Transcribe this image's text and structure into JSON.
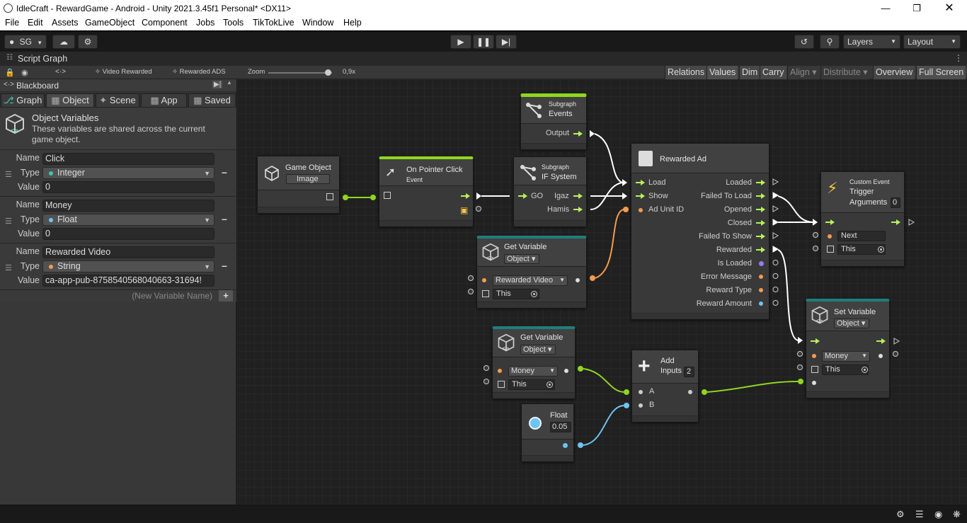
{
  "window": {
    "title": "IdleCraft - RewardGame - Android - Unity 2021.3.45f1 Personal* <DX11>"
  },
  "menu": [
    "File",
    "Edit",
    "Assets",
    "GameObject",
    "Component",
    "Jobs",
    "Tools",
    "TikTokLive",
    "Window",
    "Help"
  ],
  "toolbar": {
    "account": "SG",
    "layers": "Layers",
    "layout": "Layout"
  },
  "panel": {
    "title": "Script Graph"
  },
  "graph_toolbar": {
    "video_rewarded": "Video Rewarded",
    "rewarded_ads": "Rewarded ADS",
    "zoom_label": "Zoom",
    "zoom_value": "0,9x",
    "buttons": [
      "Relations",
      "Values",
      "Dim",
      "Carry",
      "Align ▾",
      "Distribute ▾",
      "Overview",
      "Full Screen"
    ]
  },
  "blackboard": {
    "title": "Blackboard",
    "tabs": [
      "Graph",
      "Object",
      "Scene",
      "App",
      "Saved"
    ],
    "heading": "Object Variables",
    "description": "These variables are shared across the current game object.",
    "labels": {
      "name": "Name",
      "type": "Type",
      "value": "Value"
    },
    "variables": [
      {
        "name": "Click",
        "type": "Integer",
        "value": "0",
        "color": "#39c6b8"
      },
      {
        "name": "Money",
        "type": "Float",
        "value": "0",
        "color": "#6fc3f2"
      },
      {
        "name": "Rewarded Video",
        "type": "String",
        "value": "ca-app-pub-8758540568040663-31694!",
        "color": "#f49b4e"
      }
    ],
    "new_placeholder": "(New Variable Name)"
  },
  "nodes": {
    "game_object": {
      "title": "Game Object",
      "dropdown": "Image"
    },
    "pointer_click": {
      "title": "On Pointer Click",
      "sub": "Event"
    },
    "subgraph_events": {
      "sub": "Subgraph",
      "title": "Events",
      "out": "Output"
    },
    "subgraph_if": {
      "sub": "Subgraph",
      "title": "IF System",
      "in": "GO",
      "out1": "Igaz",
      "out2": "Hamis"
    },
    "rewarded_ad": {
      "title": "Rewarded Ad",
      "inputs": [
        "Load",
        "Show",
        "Ad Unit ID"
      ],
      "outputs": [
        "Loaded",
        "Failed To Load",
        "Opened",
        "Closed",
        "Failed To Show",
        "Rewarded",
        "Is Loaded",
        "Error Message",
        "Reward Type",
        "Reward Amount"
      ]
    },
    "get_var1": {
      "title": "Get Variable",
      "kind": "Object ▾",
      "var": "Rewarded Video",
      "target": "This"
    },
    "get_var2": {
      "title": "Get Variable",
      "kind": "Object ▾",
      "var": "Money",
      "target": "This"
    },
    "float": {
      "title": "Float",
      "value": "0.05"
    },
    "add": {
      "title": "Add",
      "sub": "Inputs",
      "count": "2",
      "a": "A",
      "b": "B"
    },
    "trigger": {
      "sub": "Custom Event",
      "title": "Trigger",
      "args": "Arguments",
      "count": "0",
      "name": "Next",
      "target": "This"
    },
    "set_var": {
      "title": "Set Variable",
      "kind": "Object ▾",
      "var": "Money",
      "target": "This"
    }
  }
}
